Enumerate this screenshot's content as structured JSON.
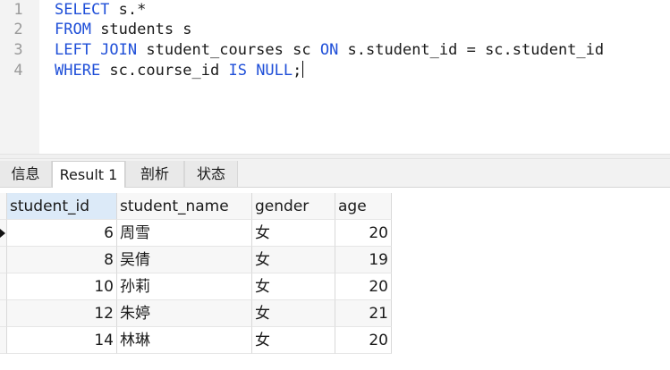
{
  "editor": {
    "lines": [
      {
        "no": "1",
        "segments": [
          {
            "t": "SELECT",
            "kw": true
          },
          {
            "t": " s.*",
            "kw": false
          }
        ]
      },
      {
        "no": "2",
        "segments": [
          {
            "t": "FROM",
            "kw": true
          },
          {
            "t": " students s",
            "kw": false
          }
        ]
      },
      {
        "no": "3",
        "segments": [
          {
            "t": "LEFT JOIN",
            "kw": true
          },
          {
            "t": " student_courses sc ",
            "kw": false
          },
          {
            "t": "ON",
            "kw": true
          },
          {
            "t": " s.student_id = sc.student_id",
            "kw": false
          }
        ]
      },
      {
        "no": "4",
        "segments": [
          {
            "t": "WHERE",
            "kw": true
          },
          {
            "t": " sc.course_id ",
            "kw": false
          },
          {
            "t": "IS NULL",
            "kw": true
          },
          {
            "t": ";",
            "kw": false
          }
        ]
      }
    ]
  },
  "tabs": [
    {
      "label": "信息",
      "active": false
    },
    {
      "label": "Result 1",
      "active": true
    },
    {
      "label": "剖析",
      "active": false
    },
    {
      "label": "状态",
      "active": false
    }
  ],
  "grid": {
    "columns": [
      "student_id",
      "student_name",
      "gender",
      "age"
    ],
    "rows": [
      [
        "6",
        "周雪",
        "女",
        "20"
      ],
      [
        "8",
        "吴倩",
        "女",
        "19"
      ],
      [
        "10",
        "孙莉",
        "女",
        "20"
      ],
      [
        "12",
        "朱婷",
        "女",
        "21"
      ],
      [
        "14",
        "林琳",
        "女",
        "20"
      ]
    ]
  },
  "colors": {
    "keyword": "#1f4fd8",
    "selected_header": "#dceaf8"
  }
}
